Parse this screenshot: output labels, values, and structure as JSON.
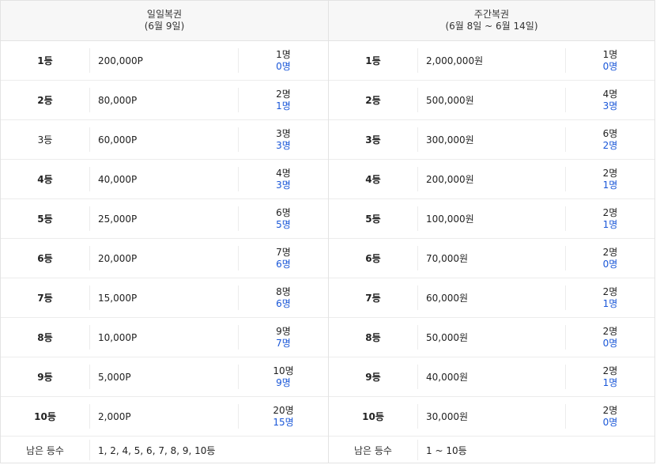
{
  "daily": {
    "title": "일일복권",
    "subtitle": "(6월 9일)",
    "rows": [
      {
        "rank": "1등",
        "prize": "200,000P",
        "total": "1명",
        "remain": "0명",
        "bold": true
      },
      {
        "rank": "2등",
        "prize": "80,000P",
        "total": "2명",
        "remain": "1명",
        "bold": true
      },
      {
        "rank": "3등",
        "prize": "60,000P",
        "total": "3명",
        "remain": "3명",
        "bold": false
      },
      {
        "rank": "4등",
        "prize": "40,000P",
        "total": "4명",
        "remain": "3명",
        "bold": true
      },
      {
        "rank": "5등",
        "prize": "25,000P",
        "total": "6명",
        "remain": "5명",
        "bold": true
      },
      {
        "rank": "6등",
        "prize": "20,000P",
        "total": "7명",
        "remain": "6명",
        "bold": true
      },
      {
        "rank": "7등",
        "prize": "15,000P",
        "total": "8명",
        "remain": "6명",
        "bold": true
      },
      {
        "rank": "8등",
        "prize": "10,000P",
        "total": "9명",
        "remain": "7명",
        "bold": true
      },
      {
        "rank": "9등",
        "prize": "5,000P",
        "total": "10명",
        "remain": "9명",
        "bold": true
      },
      {
        "rank": "10등",
        "prize": "2,000P",
        "total": "20명",
        "remain": "15명",
        "bold": true
      }
    ],
    "footer_label": "남은 등수",
    "footer_value": "1, 2, 4, 5, 6, 7, 8, 9, 10등"
  },
  "weekly": {
    "title": "주간복권",
    "subtitle": "(6월 8일 ~ 6월 14일)",
    "rows": [
      {
        "rank": "1등",
        "prize": "2,000,000원",
        "total": "1명",
        "remain": "0명",
        "bold": true
      },
      {
        "rank": "2등",
        "prize": "500,000원",
        "total": "4명",
        "remain": "3명",
        "bold": true
      },
      {
        "rank": "3등",
        "prize": "300,000원",
        "total": "6명",
        "remain": "2명",
        "bold": true
      },
      {
        "rank": "4등",
        "prize": "200,000원",
        "total": "2명",
        "remain": "1명",
        "bold": true
      },
      {
        "rank": "5등",
        "prize": "100,000원",
        "total": "2명",
        "remain": "1명",
        "bold": true
      },
      {
        "rank": "6등",
        "prize": "70,000원",
        "total": "2명",
        "remain": "0명",
        "bold": true
      },
      {
        "rank": "7등",
        "prize": "60,000원",
        "total": "2명",
        "remain": "1명",
        "bold": true
      },
      {
        "rank": "8등",
        "prize": "50,000원",
        "total": "2명",
        "remain": "0명",
        "bold": true
      },
      {
        "rank": "9등",
        "prize": "40,000원",
        "total": "2명",
        "remain": "1명",
        "bold": true
      },
      {
        "rank": "10등",
        "prize": "30,000원",
        "total": "2명",
        "remain": "0명",
        "bold": true
      }
    ],
    "footer_label": "남은 등수",
    "footer_value": "1 ~ 10등"
  },
  "colors": {
    "remaining_count": "#1a57d8",
    "header_bg": "#f7f7f7",
    "border": "#e3e3e3"
  }
}
